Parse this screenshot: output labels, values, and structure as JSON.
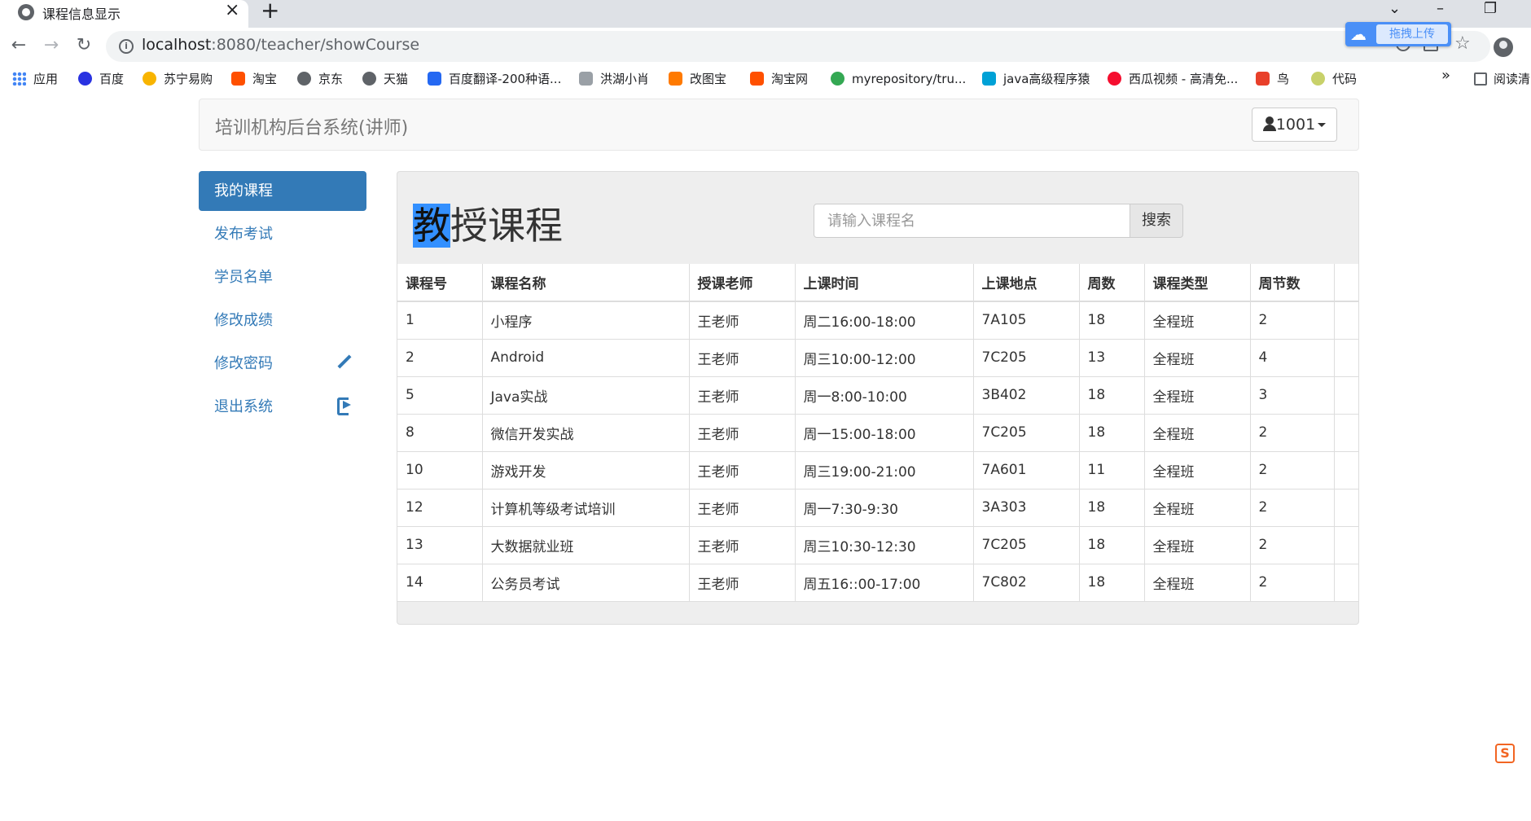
{
  "browser": {
    "tab_title": "课程信息显示",
    "url_host": "localhost",
    "url_rest": ":8080/teacher/showCourse",
    "baidu_upload_label": "拖拽上传",
    "bookmarks": [
      {
        "label": "应用",
        "icon": "apps-grid-icon",
        "color": "#4285f4"
      },
      {
        "label": "百度",
        "icon": "baidu-icon",
        "color": "#2932e1"
      },
      {
        "label": "苏宁易购",
        "icon": "suning-icon",
        "color": "#f8b400"
      },
      {
        "label": "淘宝",
        "icon": "taobao-icon",
        "color": "#ff5000"
      },
      {
        "label": "京东",
        "icon": "globe-icon",
        "color": "#5f6368"
      },
      {
        "label": "天猫",
        "icon": "globe-icon",
        "color": "#5f6368"
      },
      {
        "label": "百度翻译-200种语...",
        "icon": "translate-icon",
        "color": "#2468f2"
      },
      {
        "label": "洪湖小肖",
        "icon": "rocket-icon",
        "color": "#5f6368"
      },
      {
        "label": "改图宝",
        "icon": "gaitubao-icon",
        "color": "#ff7a00"
      },
      {
        "label": "淘宝网",
        "icon": "taobao-icon",
        "color": "#ff5000"
      },
      {
        "label": "myrepository/tru...",
        "icon": "chrome-icon",
        "color": "#34a853"
      },
      {
        "label": "java高级程序猿",
        "icon": "bilibili-icon",
        "color": "#00a1d6"
      },
      {
        "label": "西瓜视频 - 高清免...",
        "icon": "xigua-icon",
        "color": "#f50e2f"
      },
      {
        "label": "鸟",
        "icon": "bird-icon",
        "color": "#e8402a"
      },
      {
        "label": "代码",
        "icon": "leaf-icon",
        "color": "#c8d16a"
      }
    ],
    "bookmarks_more": "»",
    "reader_label": "阅读清"
  },
  "navbar": {
    "brand": "培训机构后台系统(讲师)",
    "user": "1001"
  },
  "sidebar": {
    "items": [
      {
        "label": "我的课程",
        "active": true
      },
      {
        "label": "发布考试"
      },
      {
        "label": "学员名单"
      },
      {
        "label": "修改成绩"
      },
      {
        "label": "修改密码",
        "icon": "pencil-icon"
      },
      {
        "label": "退出系统",
        "icon": "logout-icon"
      }
    ]
  },
  "main": {
    "title_highlight": "教",
    "title_rest": "授课程",
    "search_placeholder": "请输入课程名",
    "search_button": "搜索",
    "table": {
      "headers": [
        "课程号",
        "课程名称",
        "授课老师",
        "上课时间",
        "上课地点",
        "周数",
        "课程类型",
        "周节数"
      ],
      "rows": [
        [
          "1",
          "小程序",
          "王老师",
          "周二16:00-18:00",
          "7A105",
          "18",
          "全程班",
          "2"
        ],
        [
          "2",
          "Android",
          "王老师",
          "周三10:00-12:00",
          "7C205",
          "13",
          "全程班",
          "4"
        ],
        [
          "5",
          "Java实战",
          "王老师",
          "周一8:00-10:00",
          "3B402",
          "18",
          "全程班",
          "3"
        ],
        [
          "8",
          "微信开发实战",
          "王老师",
          "周一15:00-18:00",
          "7C205",
          "18",
          "全程班",
          "2"
        ],
        [
          "10",
          "游戏开发",
          "王老师",
          "周三19:00-21:00",
          "7A601",
          "11",
          "全程班",
          "2"
        ],
        [
          "12",
          "计算机等级考试培训",
          "王老师",
          "周一7:30-9:30",
          "3A303",
          "18",
          "全程班",
          "2"
        ],
        [
          "13",
          "大数据就业班",
          "王老师",
          "周三10:30-12:30",
          "7C205",
          "18",
          "全程班",
          "2"
        ],
        [
          "14",
          "公务员考试",
          "王老师",
          "周五16::00-17:00",
          "7C802",
          "18",
          "全程班",
          "2"
        ]
      ]
    }
  }
}
